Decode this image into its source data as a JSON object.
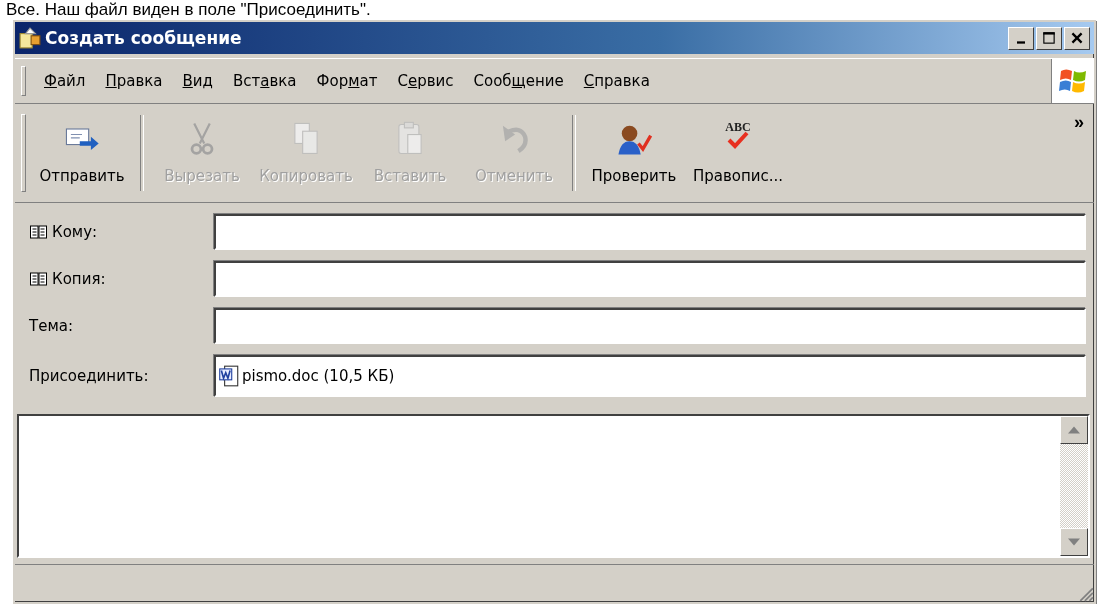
{
  "caption": "Все. Наш файл виден в поле \"Присоединить\".",
  "window": {
    "title": "Создать сообщение"
  },
  "menu": [
    {
      "key": "Ф",
      "post": "айл"
    },
    {
      "key": "П",
      "post": "равка"
    },
    {
      "key": "В",
      "post": "ид"
    },
    {
      "pre": "Вст",
      "key": "а",
      "post": "вка"
    },
    {
      "pre": "Фор",
      "key": "м",
      "post": "ат"
    },
    {
      "pre": "С",
      "key": "е",
      "post": "рвис"
    },
    {
      "pre": "Сооб",
      "key": "щ",
      "post": "ение"
    },
    {
      "key": "С",
      "post": "правка"
    }
  ],
  "toolbar": [
    {
      "kind": "send",
      "label": "Отправить",
      "disabled": false
    },
    {
      "kind": "cut",
      "label": "Вырезать",
      "disabled": true
    },
    {
      "kind": "copy",
      "label": "Копировать",
      "disabled": true
    },
    {
      "kind": "paste",
      "label": "Вставить",
      "disabled": true
    },
    {
      "kind": "undo",
      "label": "Отменить",
      "disabled": true
    },
    {
      "kind": "check",
      "label": "Проверить",
      "disabled": false
    },
    {
      "kind": "spelling",
      "label": "Правопис...",
      "disabled": false,
      "icon_text": "ABC"
    }
  ],
  "toolbar_more": "»",
  "fields": [
    {
      "kind": "address",
      "label": "Кому:"
    },
    {
      "kind": "address",
      "label": "Копия:"
    },
    {
      "kind": "plain",
      "label": "Тема:"
    },
    {
      "kind": "attach",
      "label": "Присоединить:",
      "value": "pismo.doc (10,5 КБ)"
    }
  ]
}
